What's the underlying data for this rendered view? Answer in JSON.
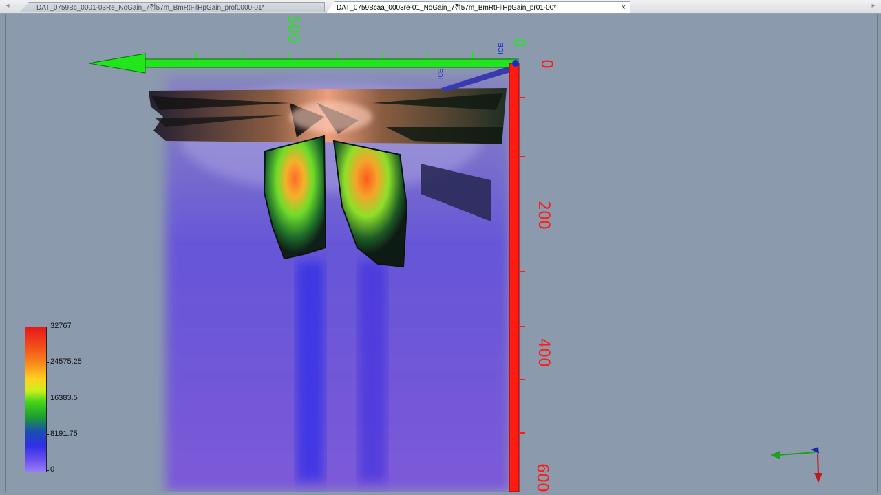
{
  "tabs": [
    {
      "label": "DAT_0759Bc_0001-03Re_NoGain_7점57m_BmRtFilHpGain_prof0000-01*",
      "active": false
    },
    {
      "label": "DAT_0759Bcaa_0003re-01_NoGain_7점57m_BmRtFilHpGain_pr01-00*",
      "active": true
    }
  ],
  "tab_close_glyph": "×",
  "tab_scroll_left": "◂",
  "tab_scroll_right": "▸",
  "scene": {
    "horizontal_axis": {
      "labels": [
        "500",
        "0"
      ],
      "color": "#22e61c"
    },
    "vertical_axis": {
      "labels": [
        "0",
        "200",
        "400",
        "600"
      ],
      "color": "#ff1a12"
    },
    "depth_axis_label": "ICE",
    "colors": {
      "background": "#8b9aad",
      "haze": "#6a52e8",
      "hot": "#ff5a1e",
      "warm": "#ffd21f",
      "mid": "#3ad61c",
      "dark": "#1b2a22"
    }
  },
  "legend": {
    "title": "",
    "max_label": "32767",
    "labels": [
      "32767",
      "24575.25",
      "16383.5",
      "8191.75",
      "0"
    ]
  },
  "orientation_gizmo": {
    "x_color": "#1fa01f",
    "y_color": "#c01818",
    "z_color": "#1a2a9a"
  },
  "icons": [
    "tab-scroll-left-icon",
    "tab-scroll-right-icon",
    "tab-close-icon",
    "axis-arrow-icon",
    "orientation-gizmo-icon"
  ]
}
